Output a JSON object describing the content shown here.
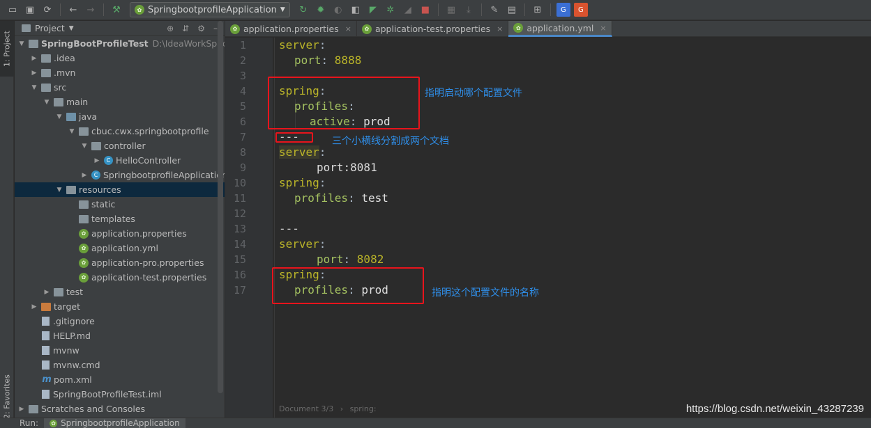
{
  "toolbar": {
    "run_config": "SpringbootprofileApplication"
  },
  "stripe": {
    "project_tab": "1: Project",
    "favorites_tab": "2: Favorites"
  },
  "project": {
    "title": "Project",
    "root_name": "SpringBootProfileTest",
    "root_path": "D:\\IdeaWorkSpace\\S",
    "items": [
      {
        "label": "SpringBootProfileTest",
        "depth": 0
      },
      {
        "label": ".idea",
        "depth": 1
      },
      {
        "label": ".mvn",
        "depth": 1
      },
      {
        "label": "src",
        "depth": 1
      },
      {
        "label": "main",
        "depth": 2
      },
      {
        "label": "java",
        "depth": 3
      },
      {
        "label": "cbuc.cwx.springbootprofile",
        "depth": 4
      },
      {
        "label": "controller",
        "depth": 5
      },
      {
        "label": "HelloController",
        "depth": 6
      },
      {
        "label": "SpringbootprofileApplication",
        "depth": 5
      },
      {
        "label": "resources",
        "depth": 3
      },
      {
        "label": "static",
        "depth": 4
      },
      {
        "label": "templates",
        "depth": 4
      },
      {
        "label": "application.properties",
        "depth": 4
      },
      {
        "label": "application.yml",
        "depth": 4
      },
      {
        "label": "application-pro.properties",
        "depth": 4
      },
      {
        "label": "application-test.properties",
        "depth": 4
      },
      {
        "label": "test",
        "depth": 2
      },
      {
        "label": "target",
        "depth": 1
      },
      {
        "label": ".gitignore",
        "depth": 1
      },
      {
        "label": "HELP.md",
        "depth": 1
      },
      {
        "label": "mvnw",
        "depth": 1
      },
      {
        "label": "mvnw.cmd",
        "depth": 1
      },
      {
        "label": "pom.xml",
        "depth": 1
      },
      {
        "label": "SpringBootProfileTest.iml",
        "depth": 1
      },
      {
        "label": "Scratches and Consoles",
        "depth": 0
      }
    ]
  },
  "tabs": [
    {
      "label": "application.properties"
    },
    {
      "label": "application-test.properties"
    },
    {
      "label": "application.yml"
    }
  ],
  "editor": {
    "line_numbers": [
      "1",
      "2",
      "3",
      "4",
      "5",
      "6",
      "7",
      "8",
      "9",
      "10",
      "11",
      "12",
      "13",
      "14",
      "15",
      "16",
      "17"
    ],
    "lines": {
      "l1_key": "server",
      "l1_colon": ":",
      "l2_key": "port",
      "l2_colon": ": ",
      "l2_val": "8888",
      "l4_key": "spring",
      "l4_colon": ":",
      "l5_key": "profiles",
      "l5_colon": ":",
      "l6_key": "active",
      "l6_colon": ": ",
      "l6_val": "prod",
      "l7": "---",
      "l8_key": "server",
      "l8_colon": ":",
      "l9": "port:8081",
      "l10_key": "spring",
      "l10_colon": ":",
      "l11_key": "profiles",
      "l11_colon": ": ",
      "l11_val": "test",
      "l13": "---",
      "l14_key": "server",
      "l14_colon": ":",
      "l15_key": "port",
      "l15_colon": ": ",
      "l15_val": "8082",
      "l16_key": "spring",
      "l16_colon": ":",
      "l17_key": "profiles",
      "l17_colon": ": ",
      "l17_val": "prod"
    },
    "annotations": {
      "a1": "指明启动哪个配置文件",
      "a2": "三个小横线分割成两个文档",
      "a3": "指明这个配置文件的名称"
    },
    "breadcrumb_doc": "Document 3/3",
    "breadcrumb_sep": "›",
    "breadcrumb_key": "spring:",
    "watermark": "https://blog.csdn.net/weixin_43287239"
  },
  "bottom": {
    "run_label": "Run:",
    "run_tab": "SpringbootprofileApplication"
  }
}
